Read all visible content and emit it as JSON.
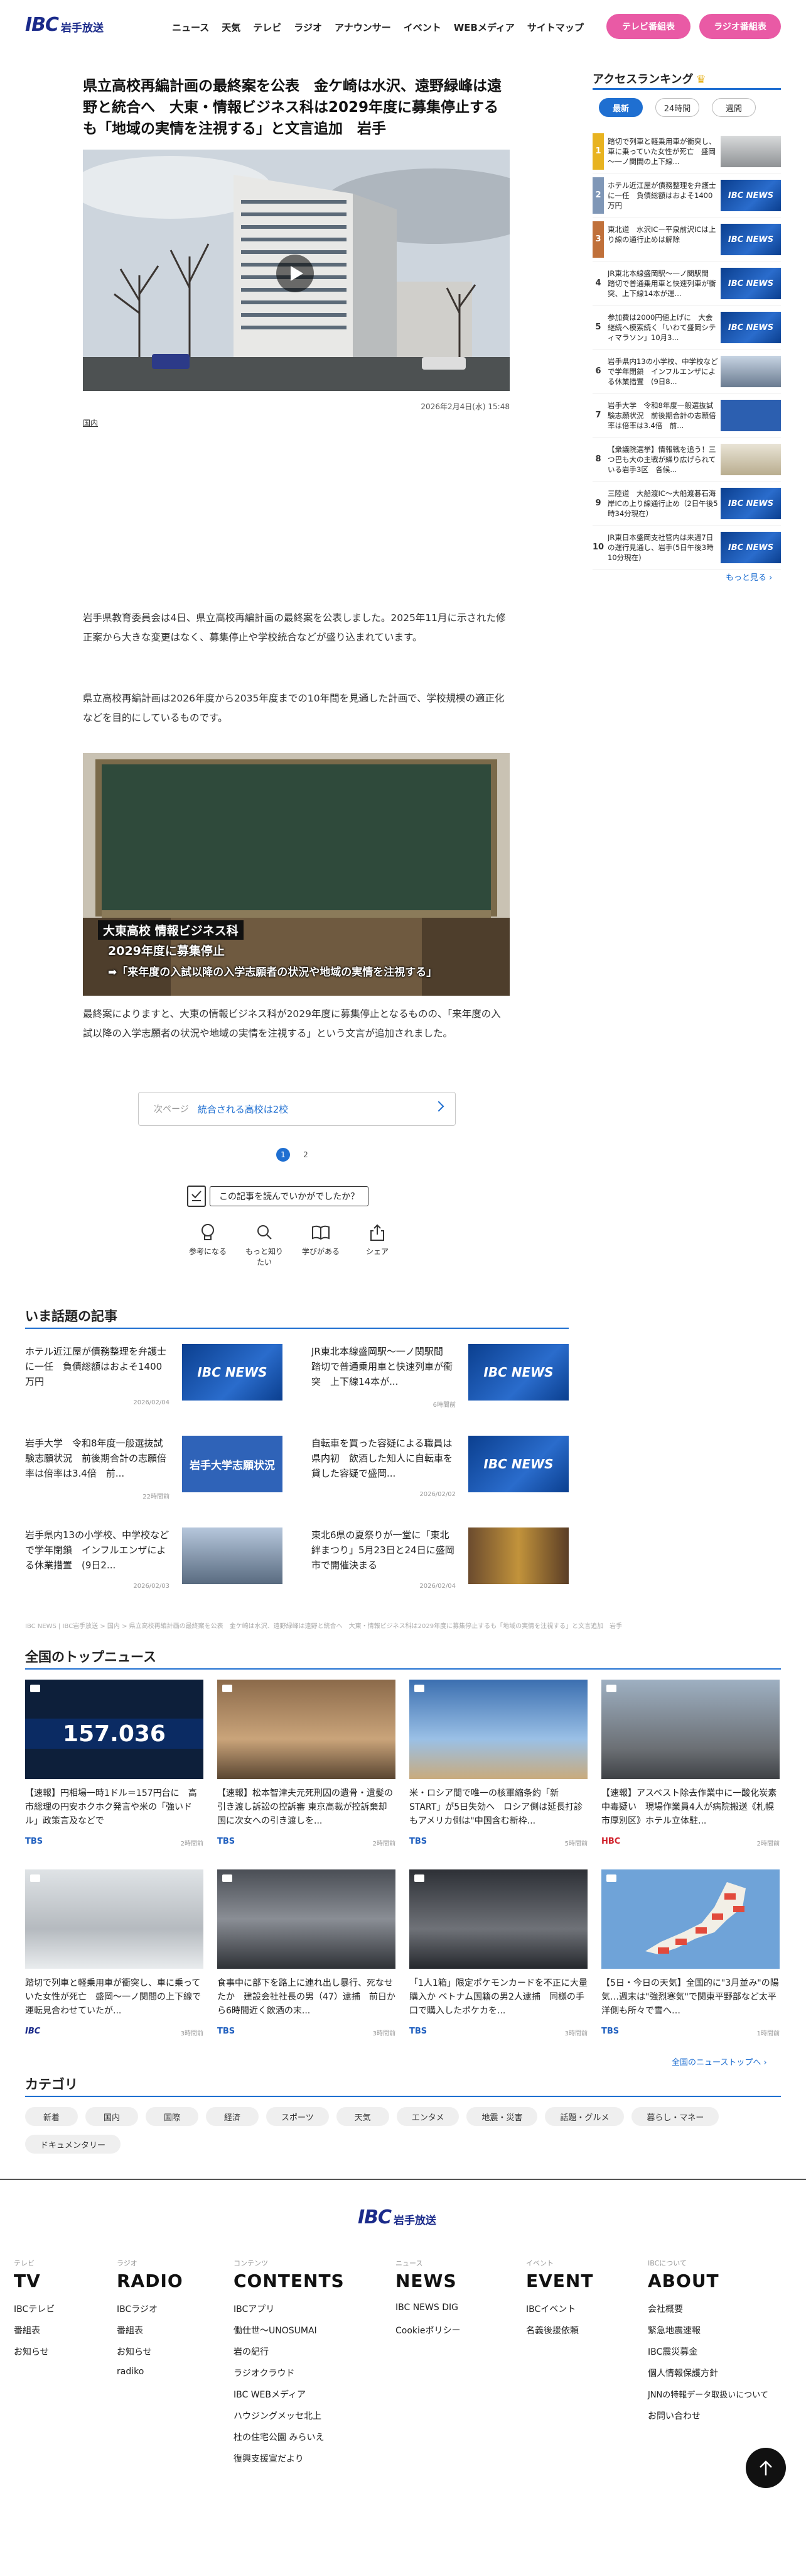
{
  "header": {
    "logo_mark": "IBC",
    "logo_text": "岩手放送",
    "nav": [
      "ニュース",
      "天気",
      "テレビ",
      "ラジオ",
      "アナウンサー",
      "イベント",
      "WEBメディア",
      "サイトマップ"
    ],
    "btn_tv": "テレビ番組表",
    "btn_radio": "ラジオ番組表"
  },
  "article": {
    "headline": "県立高校再編計画の最終案を公表　金ケ崎は水沢、遠野緑峰は遠野と統合へ　大東・情報ビジネス科は2029年度に募集停止するも「地域の実情を注視する」と文言追加　岩手",
    "date": "2026年2月4日(水) 15:48",
    "category": "国内",
    "p1": "岩手県教育委員会は4日、県立高校再編計画の最終案を公表しました。2025年11月に示された修正案から大きな変更はなく、募集停止や学校統合などが盛り込まれています。",
    "p2": "県立高校再編計画は2026年度から2035年度までの10年間を見通した計画で、学校規模の適正化などを目的にしているものです。",
    "caption_line1": "大東高校 情報ビジネス科",
    "caption_line2": "2029年度に募集停止",
    "caption_line3": "➡「来年度の入試以降の入学志願者の状況や地域の実情を注視する」",
    "p3": "最終案によりますと、大東の情報ビジネス科が2029年度に募集停止となるものの、「来年度の入試以降の入学志願者の状況や地域の実情を注視する」という文言が追加されました。",
    "next_label": "次ページ",
    "next_title": "統合される高校は2校",
    "pages": [
      "1",
      "2"
    ],
    "feedback_question": "この記事を読んでいかがでしたか？",
    "reactions": [
      "参考になる",
      "もっと知りたい",
      "学びがある",
      "シェア"
    ]
  },
  "ranking": {
    "title": "アクセスランキング",
    "crown": "♛",
    "tabs": [
      "最新",
      "24時間",
      "週間"
    ],
    "items": [
      {
        "num": "1",
        "text": "踏切で列車と軽乗用車が衝突し、車に乗っていた女性が死亡　盛岡～一ノ関間の上下線..."
      },
      {
        "num": "2",
        "text": "ホテル近江屋が債務整理を弁護士に一任　負債総額はおよそ1400万円"
      },
      {
        "num": "3",
        "text": "東北道　水沢ICー平泉前沢ICは上り線の通行止めは解除"
      },
      {
        "num": "4",
        "text": "JR東北本線盛岡駅〜一ノ関駅間　踏切で普通乗用車と快速列車が衝突、上下線14本が運..."
      },
      {
        "num": "5",
        "text": "参加費は2000円値上げに　大会継続へ模索続く「いわて盛岡シティマラソン」10月3..."
      },
      {
        "num": "6",
        "text": "岩手県内13の小学校、中学校などで学年閉鎖　インフルエンザによる休業措置　(9日8..."
      },
      {
        "num": "7",
        "text": "岩手大学　令和8年度一般選抜試験志願状況　前後期合計の志願倍率は倍率は3.4倍　前..."
      },
      {
        "num": "8",
        "text": "【衆議院選挙】情報戦を追う！三つ巴も大の主戦が繰り広げられている岩手3区　各候..."
      },
      {
        "num": "9",
        "text": "三陸道　大船渡IC〜大船渡碁石海岸ICの上り線通行止め（2日午後5時34分現在）"
      },
      {
        "num": "10",
        "text": "JR東日本盛岡支社管内は来週7日の運行見通し、岩手(5日午後3時10分現在)"
      }
    ],
    "more": "もっと見る ›"
  },
  "trending": {
    "title": "いま話題の記事",
    "items": [
      {
        "text": "ホテル近江屋が債務整理を弁護士に一任　負債総額はおよそ1400万円",
        "date": "2026/02/04",
        "thumb": "IBC NEWS"
      },
      {
        "text": "JR東北本線盛岡駅〜一ノ関駅間　踏切で普通乗用車と快速列車が衝突　上下線14本が...",
        "date": "6時間前",
        "thumb": "IBC NEWS"
      },
      {
        "text": "岩手大学　令和8年度一般選抜試験志願状況　前後期合計の志願倍率は倍率は3.4倍　前...",
        "date": "22時間前",
        "thumb": "岩手大学志願状況"
      },
      {
        "text": "自転車を買った容疑による職員は県内初　飲酒した知人に自転車を貸した容疑で盛岡...",
        "date": "2026/02/02",
        "thumb": "IBC NEWS"
      },
      {
        "text": "岩手県内13の小学校、中学校などで学年閉鎖　インフルエンザによる休業措置　(9日2...",
        "date": "2026/02/03",
        "thumb": ""
      },
      {
        "text": "東北6県の夏祭りが一堂に「東北絆まつり」5月23日と24日に盛岡市で開催決まる",
        "date": "2026/02/04",
        "thumb": ""
      }
    ]
  },
  "breadcrumb": "IBC NEWS | IBC岩手放送 > 国内 > 県立高校再編計画の最終案を公表　金ケ崎は水沢、遠野緑峰は遠野と統合へ　大東・情報ビジネス科は2029年度に募集停止するも「地域の実情を注視する」と文言追加　岩手",
  "national": {
    "title": "全国のトップニュース",
    "items": [
      {
        "text": "【速報】円相場一時1ドル＝157円台に　高市総理の円安ホクホク発言や米の「強いドル」政策言及などで",
        "src": "TBS",
        "time": "2時間前",
        "img": "157.036"
      },
      {
        "text": "【速報】松本智津夫元死刑囚の遺骨・遺髪の引き渡し訴訟の控訴審 東京高裁が控訴棄却 国に次女への引き渡しを...",
        "src": "TBS",
        "time": "2時間前",
        "img": "court"
      },
      {
        "text": "米・ロシア間で唯一の核軍縮条約「新START」が5日失効へ　ロシア側は延長打診もアメリカ側は\"中国含む新枠...",
        "src": "TBS",
        "time": "5時間前",
        "img": "rocket"
      },
      {
        "text": "【速報】アスベスト除去作業中に一酸化炭素中毒疑い　現場作業員4人が病院搬送《札幌市厚別区》ホテル立体駐...",
        "src": "HBC",
        "time": "2時間前",
        "img": "building"
      },
      {
        "text": "踏切で列車と軽乗用車が衝突し、車に乗っていた女性が死亡　盛岡～一ノ関間の上下線で運転見合わせていたが...",
        "src": "IBC",
        "time": "3時間前",
        "img": "car"
      },
      {
        "text": "食事中に部下を路上に連れ出し暴行、死なせたか　建設会社社長の男（47）逮捕　前日から6時間近く飲酒の末...",
        "src": "TBS",
        "time": "3時間前",
        "img": "man"
      },
      {
        "text": "「1人1箱」限定ポケモンカードを不正に大量購入か ベトナム国籍の男2人逮捕　同様の手口で購入したポケカを...",
        "src": "TBS",
        "time": "3時間前",
        "img": "men"
      },
      {
        "text": "【5日・今日の天気】全国的に\"3月並み\"の陽気…週末は\"強烈寒気\"で関東平野部など太平洋側も所々で雪へ…",
        "src": "TBS",
        "time": "1時間前",
        "img": "map"
      }
    ],
    "more": "全国のニューストップへ ›"
  },
  "categories": {
    "title": "カテゴリ",
    "items": [
      "新着",
      "国内",
      "国際",
      "経済",
      "スポーツ",
      "天気",
      "エンタメ",
      "地震・災害",
      "話題・グルメ",
      "暮らし・マネー",
      "ドキュメンタリー"
    ]
  },
  "footer": {
    "logo_mark": "IBC",
    "logo_text": "岩手放送",
    "cols": [
      {
        "sub": "テレビ",
        "head": "TV",
        "links": [
          "IBCテレビ",
          "番組表",
          "お知らせ"
        ]
      },
      {
        "sub": "ラジオ",
        "head": "RADIO",
        "links": [
          "IBCラジオ",
          "番組表",
          "お知らせ",
          "radiko"
        ]
      },
      {
        "sub": "コンテンツ",
        "head": "CONTENTS",
        "links": [
          "IBCアプリ",
          "働仕世〜UNOSUMAI",
          "岩の紀行",
          "ラジオクラウド",
          "IBC WEBメディア",
          "ハウジングメッセ北上",
          "杜の住宅公園 みらいえ",
          "復興支援宣だより"
        ]
      },
      {
        "sub": "ニュース",
        "head": "NEWS",
        "links": [
          "IBC NEWS DIG",
          "Cookieポリシー"
        ]
      },
      {
        "sub": "イベント",
        "head": "EVENT",
        "links": [
          "IBCイベント",
          "名義後援依頼"
        ]
      },
      {
        "sub": "IBCについて",
        "head": "ABOUT",
        "links": [
          "会社概要",
          "緊急地震速報",
          "IBC震災募金",
          "個人情報保護方針",
          "JNNの特報データ取扱いについて",
          "お問い合わせ"
        ]
      }
    ]
  },
  "colors": {
    "accent": "#1f6fd1",
    "pink": "#e95aa5",
    "brand": "#1a2a8a"
  }
}
